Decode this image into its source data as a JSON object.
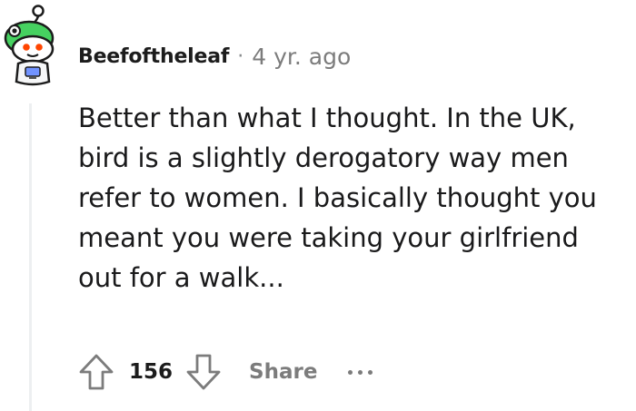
{
  "comment": {
    "author": "Beefoftheleaf",
    "separator": "·",
    "age": "4 yr. ago",
    "avatar_icon": "snoo-avatar-icon",
    "body": "Better than what I thought. In the UK, bird is a slightly derogatory way men refer to women. I basically thought you meant you were taking your girlfriend out for a walk...",
    "score": "156",
    "share_label": "Share",
    "upvote_icon": "upvote-arrow-icon",
    "downvote_icon": "downvote-arrow-icon",
    "more_icon": "ellipsis-icon"
  },
  "colors": {
    "text": "#1a1a1b",
    "meta": "#7c7c7c",
    "thread_line": "#edeff1",
    "avatar_green": "#46d160"
  }
}
